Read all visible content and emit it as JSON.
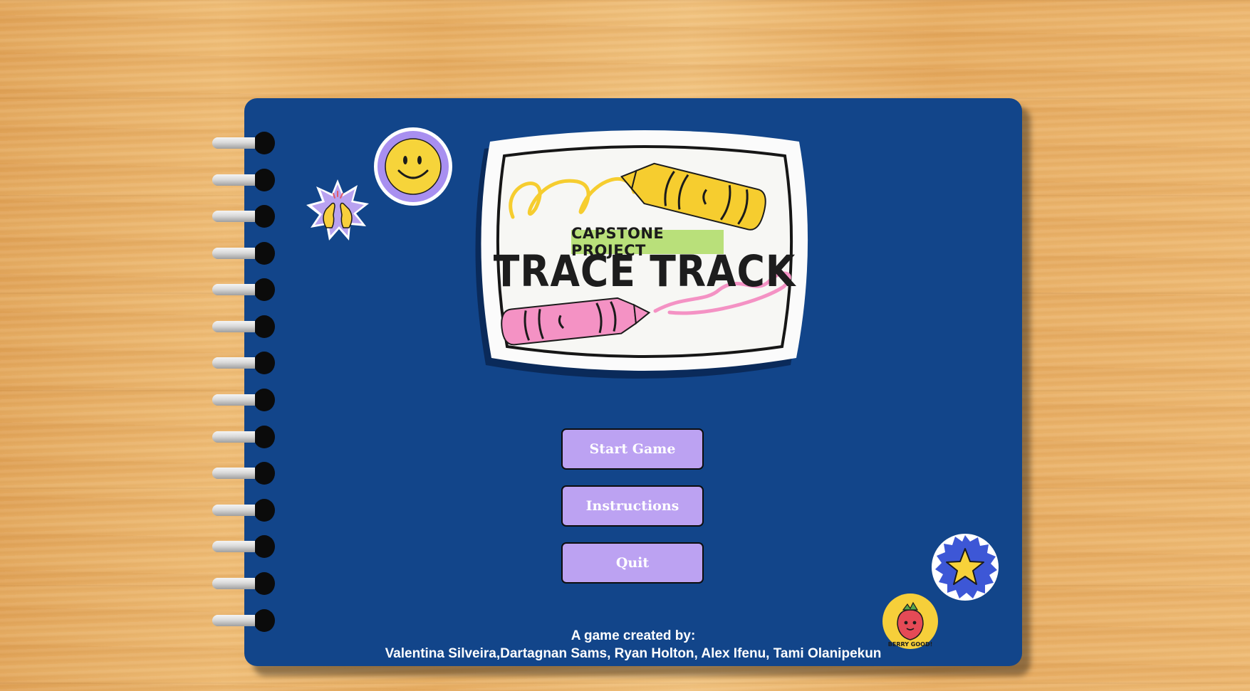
{
  "logo": {
    "badge": "CAPSTONE PROJECT",
    "title": "TRACE TRACK"
  },
  "menu": {
    "start_label": "Start Game",
    "instructions_label": "Instructions",
    "quit_label": "Quit"
  },
  "credits": {
    "heading": "A game created by:",
    "names": "Valentina Silveira,Dartagnan Sams, Ryan Holton, Alex Ifenu, Tami Olanipekun"
  },
  "stickers": {
    "berry_text": "BERRY GOOD!"
  },
  "colors": {
    "cover": "#12458a",
    "button": "#bca2f2",
    "badge": "#b9e07a",
    "yellow_crayon": "#f6cd2f",
    "pink_crayon": "#f492c4"
  }
}
